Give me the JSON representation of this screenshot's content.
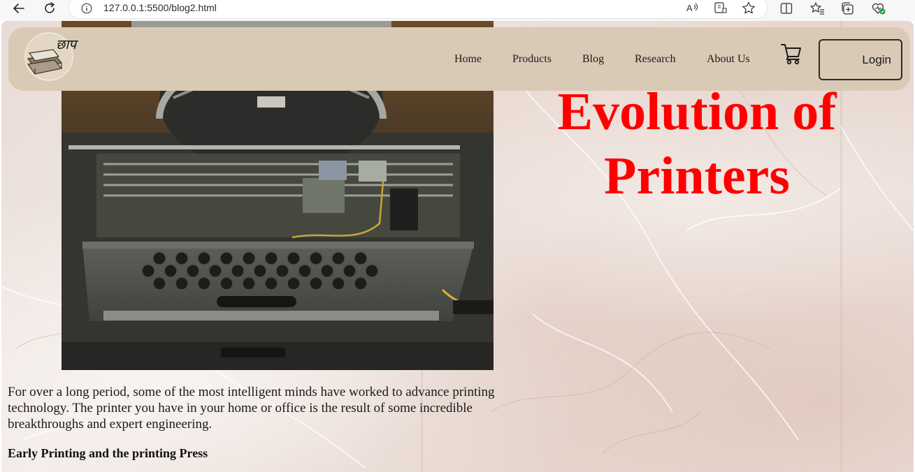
{
  "browser": {
    "url": "127.0.0.1:5500/blog2.html"
  },
  "navbar": {
    "logo_text": "छाप",
    "links": [
      "Home",
      "Products",
      "Blog",
      "Research",
      "About Us"
    ],
    "cart_icon": "cart-icon",
    "login_label": "Login"
  },
  "hero": {
    "title": "Evolution of Printers",
    "image_subject": "typewriter"
  },
  "content": {
    "intro": "For over a long period, some of the most intelligent minds have worked to advance printing technology. The printer you have in your home or office is the result of some incredible breakthroughs and expert engineering.",
    "section_heading": "Early Printing and the printing Press"
  },
  "colors": {
    "title": "#ff0000",
    "navbar_bg": "#d9cab6",
    "page_bg": "#ece0da"
  }
}
